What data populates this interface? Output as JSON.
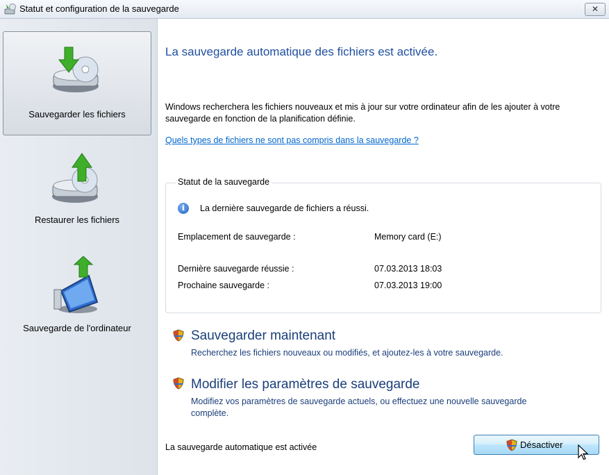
{
  "window": {
    "title": "Statut et configuration de la sauvegarde",
    "close_glyph": "✕"
  },
  "sidebar": {
    "items": [
      {
        "label": "Sauvegarder les fichiers",
        "icon": "backup-files-icon",
        "active": true
      },
      {
        "label": "Restaurer les fichiers",
        "icon": "restore-files-icon",
        "active": false
      },
      {
        "label": "Sauvegarde de l'ordinateur",
        "icon": "computer-backup-icon",
        "active": false
      }
    ]
  },
  "main": {
    "headline": "La sauvegarde automatique des fichiers est activée.",
    "description": "Windows recherchera les fichiers nouveaux et mis à jour sur votre ordinateur afin de les ajouter à votre sauvegarde en fonction de la planification définie.",
    "link": "Quels types de fichiers ne sont pas compris dans la sauvegarde ?",
    "status": {
      "group_title": "Statut de la sauvegarde",
      "message": "La dernière sauvegarde de fichiers a réussi.",
      "rows": [
        {
          "label": "Emplacement de sauvegarde :",
          "value": "Memory card (E:)"
        },
        {
          "label": "Dernière sauvegarde réussie :",
          "value": "07.03.2013 18:03"
        },
        {
          "label": "Prochaine sauvegarde :",
          "value": "07.03.2013 19:00"
        }
      ]
    },
    "actions": [
      {
        "title": "Sauvegarder maintenant",
        "description": "Recherchez les fichiers nouveaux ou modifiés, et ajoutez-les à votre sauvegarde."
      },
      {
        "title": "Modifier les paramètres de sauvegarde",
        "description": "Modifiez vos paramètres de sauvegarde actuels, ou effectuez une nouvelle sauvegarde complète."
      }
    ],
    "footer_status": "La sauvegarde automatique est activée",
    "disable_button": "Désactiver"
  },
  "colors": {
    "headline": "#1f4f9f",
    "link": "#0066cc",
    "action_text": "#1a3e7a"
  }
}
